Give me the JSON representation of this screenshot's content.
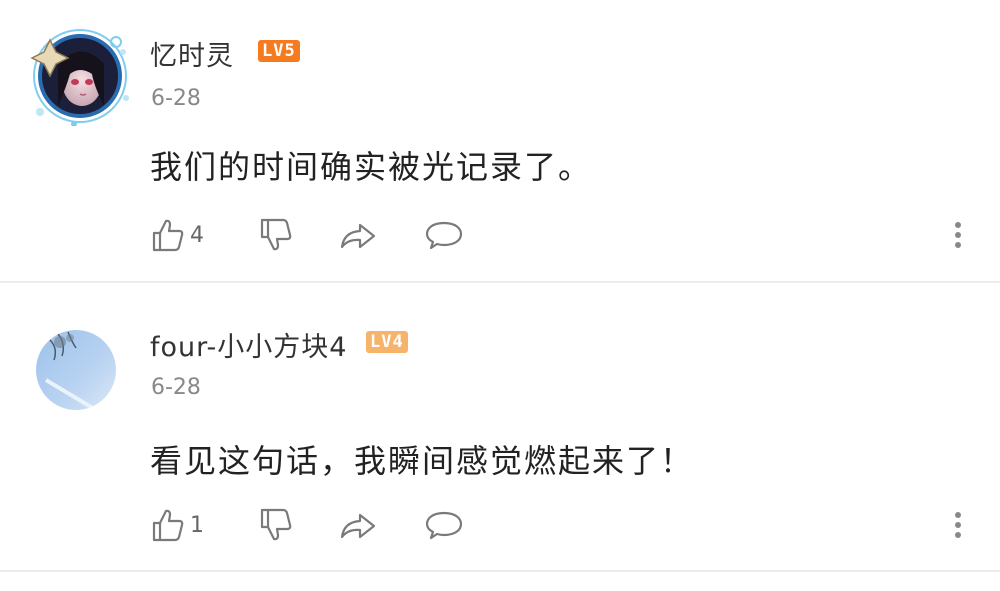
{
  "comments": [
    {
      "username": "忆时灵",
      "level": "LV5",
      "level_color": "#f57b20",
      "date": "6-28",
      "content": "我们的时间确实被光记录了。",
      "likes": "4",
      "avatar": "anime-girl-avatar-with-frame"
    },
    {
      "username": "four-小小方块4",
      "level": "LV4",
      "level_color": "#f7b36a",
      "date": "6-28",
      "content": "看见这句话，我瞬间感觉燃起来了！",
      "likes": "1",
      "avatar": "blue-sky-avatar"
    }
  ],
  "icons": {
    "like": "thumbs-up-icon",
    "dislike": "thumbs-down-icon",
    "share": "share-arrow-icon",
    "comment": "comment-bubble-icon",
    "more": "more-vertical-icon"
  },
  "colors": {
    "text_primary": "#222222",
    "text_secondary": "#888888",
    "icon": "#7a7a7a",
    "divider": "#ececec"
  }
}
